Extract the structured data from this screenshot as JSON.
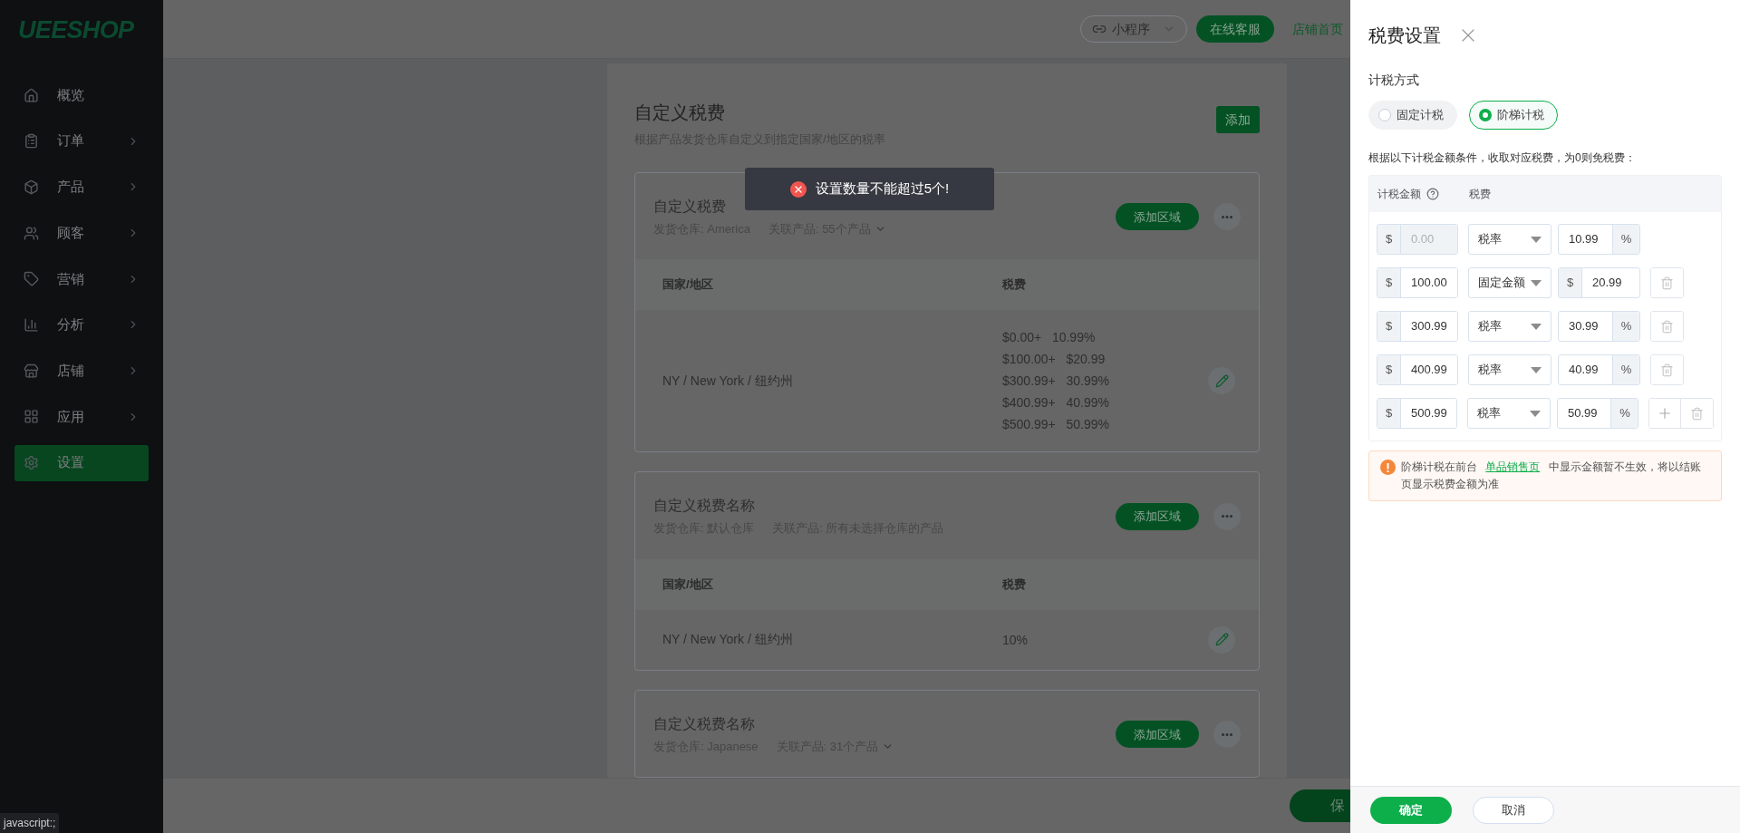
{
  "sidebar": {
    "logo": "UEESHOP",
    "items": [
      {
        "label": "概览",
        "has_arrow": false,
        "selected": false
      },
      {
        "label": "订单",
        "has_arrow": true,
        "selected": false
      },
      {
        "label": "产品",
        "has_arrow": true,
        "selected": false
      },
      {
        "label": "顾客",
        "has_arrow": true,
        "selected": false
      },
      {
        "label": "营销",
        "has_arrow": true,
        "selected": false
      },
      {
        "label": "分析",
        "has_arrow": true,
        "selected": false
      },
      {
        "label": "店铺",
        "has_arrow": true,
        "selected": false
      },
      {
        "label": "应用",
        "has_arrow": true,
        "selected": false
      },
      {
        "label": "设置",
        "has_arrow": false,
        "selected": true
      }
    ]
  },
  "link_tooltip": "javascript:;",
  "topbar": {
    "mini_program": "小程序",
    "support_button": "在线客服",
    "store_link": "店铺首页"
  },
  "page": {
    "title": "自定义税费",
    "subtitle": "根据产品发货仓库自定义到指定国家/地区的税率",
    "add_button": "添加",
    "tax_groups": [
      {
        "name": "自定义税费",
        "warehouse": "发货仓库: America",
        "products": "关联产品: 55个产品",
        "products_expandable": true,
        "add_region_button": "添加区域",
        "columns": [
          "国家/地区",
          "税费"
        ],
        "rows": [
          {
            "region": "NY / New York / 纽约州",
            "tax_lines": [
              {
                "threshold": "$0.00+",
                "value": "10.99%"
              },
              {
                "threshold": "$100.00+",
                "value": "$20.99"
              },
              {
                "threshold": "$300.99+",
                "value": "30.99%"
              },
              {
                "threshold": "$400.99+",
                "value": "40.99%"
              },
              {
                "threshold": "$500.99+",
                "value": "50.99%"
              }
            ]
          }
        ]
      },
      {
        "name": "自定义税费名称",
        "warehouse": "发货仓库: 默认仓库",
        "products": "关联产品: 所有未选择仓库的产品",
        "products_expandable": false,
        "add_region_button": "添加区域",
        "columns": [
          "国家/地区",
          "税费"
        ],
        "rows": [
          {
            "region": "NY / New York / 纽约州",
            "tax_lines": [
              {
                "value": "10%"
              }
            ]
          }
        ]
      },
      {
        "name": "自定义税费名称",
        "warehouse": "发货仓库: Japanese",
        "products": "关联产品: 31个产品",
        "products_expandable": true,
        "add_region_button": "添加区域"
      }
    ],
    "save_button": "保"
  },
  "toast": {
    "kind": "error",
    "message": "设置数量不能超过5个!"
  },
  "drawer": {
    "title": "税费设置",
    "method_label": "计税方式",
    "methods": [
      {
        "label": "固定计税",
        "selected": false
      },
      {
        "label": "阶梯计税",
        "selected": true
      }
    ],
    "description": "根据以下计税金额条件，收取对应税费，为0则免税费：",
    "columns": [
      "计税金额",
      "税费"
    ],
    "tiers": [
      {
        "kind": "rate",
        "amount_prefix": "$",
        "amount": "0.00",
        "amount_disabled": true,
        "type": "税率",
        "unit": "%",
        "value": "10.99",
        "can_add": false,
        "can_delete": false
      },
      {
        "kind": "fixed",
        "amount_prefix": "$",
        "amount": "100.00",
        "amount_disabled": false,
        "type": "固定金额",
        "unit": "$",
        "value": "20.99",
        "can_add": false,
        "can_delete": true
      },
      {
        "kind": "rate",
        "amount_prefix": "$",
        "amount": "300.99",
        "amount_disabled": false,
        "type": "税率",
        "unit": "%",
        "value": "30.99",
        "can_add": false,
        "can_delete": true
      },
      {
        "kind": "rate",
        "amount_prefix": "$",
        "amount": "400.99",
        "amount_disabled": false,
        "type": "税率",
        "unit": "%",
        "value": "40.99",
        "can_add": false,
        "can_delete": true
      },
      {
        "kind": "rate",
        "amount_prefix": "$",
        "amount": "500.99",
        "amount_disabled": false,
        "type": "税率",
        "unit": "%",
        "value": "50.99",
        "can_add": true,
        "can_delete": true
      }
    ],
    "note": {
      "before": "阶梯计税在前台",
      "link": "单品销售页",
      "after": "中显示金额暂不生效，将以结账页显示税费金额为准"
    },
    "confirm_button": "确定",
    "cancel_button": "取消"
  }
}
